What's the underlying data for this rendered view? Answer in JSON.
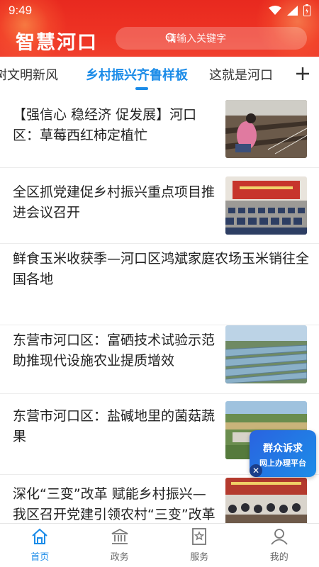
{
  "status_bar": {
    "time": "9:49"
  },
  "header": {
    "app_title": "智慧河口",
    "search_placeholder": "请输入关键字"
  },
  "tabs": [
    {
      "label": "树文明新风"
    },
    {
      "label": "乡村振兴齐鲁样板",
      "active": true
    },
    {
      "label": "这就是河口"
    }
  ],
  "news": [
    {
      "title": "【强信心 稳经济 促发展】河口区：草莓西红柿定植忙",
      "has_image": true
    },
    {
      "title": "全区抓党建促乡村振兴重点项目推进会议召开",
      "has_image": true
    },
    {
      "title": "鲜食玉米收获季—河口区鸿斌家庭农场玉米销往全国各地",
      "has_image": false
    },
    {
      "title": "东营市河口区：富硒技术试验示范　助推现代设施农业提质增效",
      "has_image": true
    },
    {
      "title": "东营市河口区：盐碱地里的菌菇蔬果",
      "has_image": true
    },
    {
      "title": "深化“三变”改革 赋能乡村振兴—我区召开党建引领农村“三变”改革推进会议",
      "has_image": true
    }
  ],
  "float_ad": {
    "line1": "群众诉求",
    "line2": "网上办理平台"
  },
  "bottom_nav": [
    {
      "label": "首页",
      "icon": "home-icon",
      "active": true
    },
    {
      "label": "政务",
      "icon": "government-icon"
    },
    {
      "label": "服务",
      "icon": "service-icon"
    },
    {
      "label": "我的",
      "icon": "user-icon"
    }
  ],
  "colors": {
    "brand_red": "#ee3324",
    "accent_blue": "#1a8be8"
  }
}
